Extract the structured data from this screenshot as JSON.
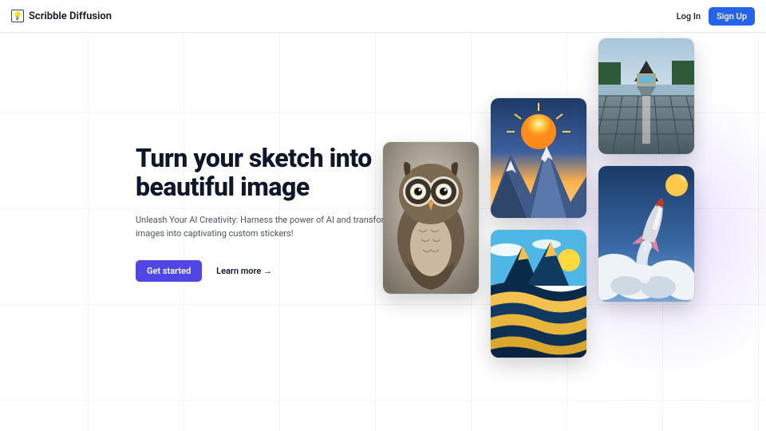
{
  "header": {
    "brand": "Scribble Diffusion",
    "login": "Log In",
    "signup": "Sign Up"
  },
  "hero": {
    "title_line1": "Turn your sketch into",
    "title_line2": "beautiful image",
    "subtitle": "Unleash Your AI Creativity: Harness the power of AI and transform your images into captivating custom stickers!",
    "cta_primary": "Get started",
    "cta_secondary": "Learn more →"
  },
  "gallery": {
    "cards": [
      {
        "name": "owl-illustration"
      },
      {
        "name": "mountain-sunset"
      },
      {
        "name": "abstract-waves"
      },
      {
        "name": "lake-cabin"
      },
      {
        "name": "rocket-launch"
      }
    ]
  }
}
